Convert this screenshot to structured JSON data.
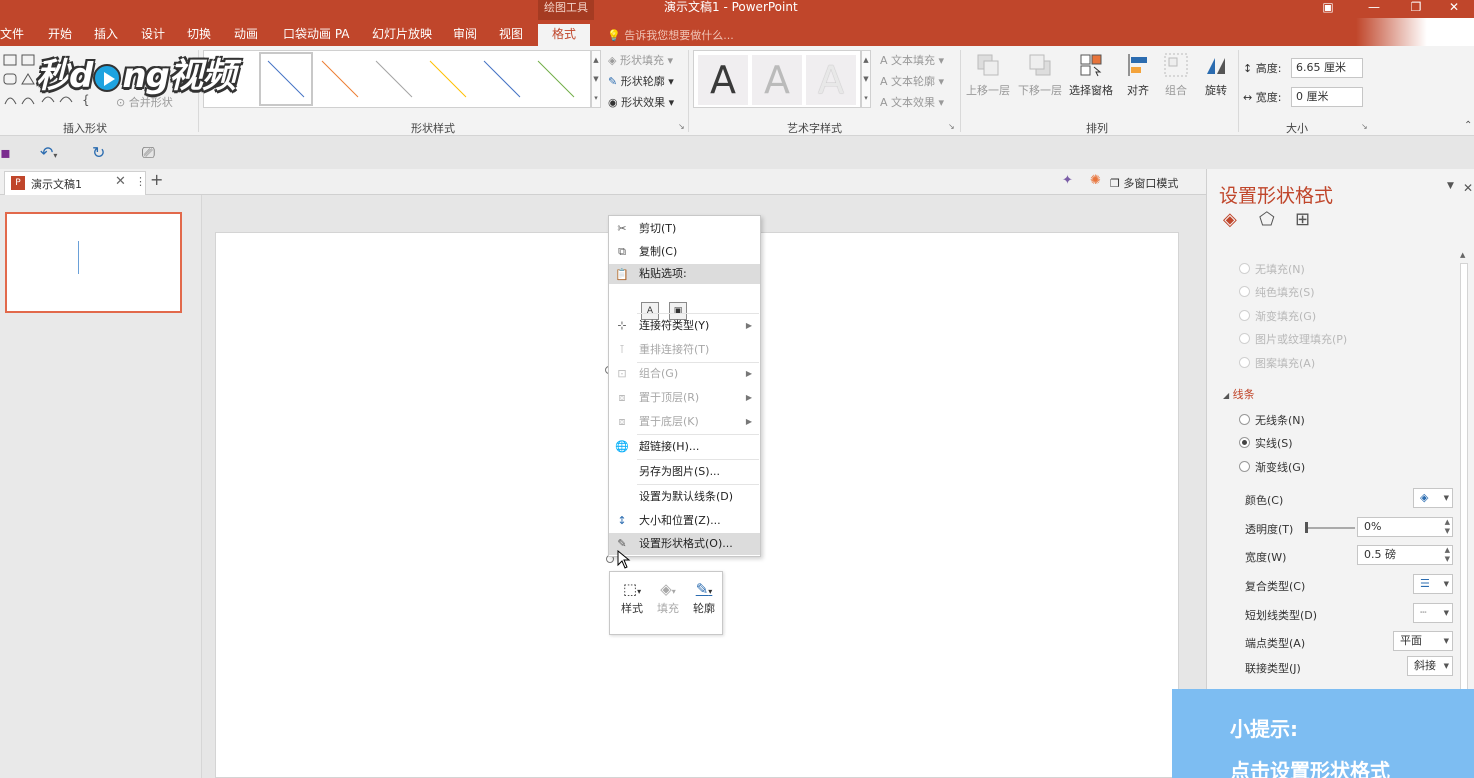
{
  "window": {
    "context_tab": "绘图工具",
    "title": "演示文稿1 - PowerPoint"
  },
  "tabs": [
    {
      "label": "文件"
    },
    {
      "label": "开始"
    },
    {
      "label": "插入"
    },
    {
      "label": "设计"
    },
    {
      "label": "切换"
    },
    {
      "label": "动画"
    },
    {
      "label": "口袋动画 PA"
    },
    {
      "label": "幻灯片放映"
    },
    {
      "label": "审阅"
    },
    {
      "label": "视图"
    },
    {
      "label": "格式"
    }
  ],
  "tellme": "告诉我您想要做什么...",
  "ribbon": {
    "groups": {
      "insert_shapes": "插入形状",
      "shape_styles": "形状样式",
      "wordart_styles": "艺术字样式",
      "arrange": "排列",
      "size": "大小"
    },
    "merge_shapes": "合并形状",
    "shape_fill": "形状填充",
    "shape_outline": "形状轮廓",
    "shape_effects": "形状效果",
    "text_fill": "文本填充",
    "text_outline": "文本轮廓",
    "text_effects": "文本效果",
    "wordart_letter": "A",
    "bring_forward": "上移一层",
    "send_backward": "下移一层",
    "selection_pane": "选择窗格",
    "align": "对齐",
    "group": "组合",
    "rotate": "旋转",
    "height_label": "高度:",
    "height_value": "6.65 厘米",
    "width_label": "宽度:",
    "width_value": "0 厘米"
  },
  "doc_tab": {
    "name": "演示文稿1",
    "multi_window": "多窗口模式"
  },
  "context_menu": {
    "cut": "剪切(T)",
    "copy": "复制(C)",
    "paste_options": "粘贴选项:",
    "connector_type": "连接符类型(Y)",
    "reroute_connectors": "重排连接符(T)",
    "group": "组合(G)",
    "bring_to_front": "置于顶层(R)",
    "send_to_back": "置于底层(K)",
    "hyperlink": "超链接(H)...",
    "save_as_picture": "另存为图片(S)...",
    "set_default_line": "设置为默认线条(D)",
    "size_position": "大小和位置(Z)...",
    "format_shape": "设置形状格式(O)..."
  },
  "mini_toolbar": {
    "style": "样式",
    "fill": "填充",
    "outline": "轮廓"
  },
  "pane": {
    "title": "设置形状格式",
    "fill_options": [
      "无填充(N)",
      "纯色填充(S)",
      "渐变填充(G)",
      "图片或纹理填充(P)",
      "图案填充(A)"
    ],
    "line_section": "线条",
    "line_options": [
      "无线条(N)",
      "实线(S)",
      "渐变线(G)"
    ],
    "color_label": "颜色(C)",
    "transparency_label": "透明度(T)",
    "transparency_value": "0%",
    "width_label": "宽度(W)",
    "width_value": "0.5 磅",
    "compound_label": "复合类型(C)",
    "dash_label": "短划线类型(D)",
    "cap_label": "端点类型(A)",
    "cap_value": "平面",
    "join_label": "联接类型(J)",
    "join_value": "斜接"
  },
  "logo": {
    "part1": "秒",
    "part2": "d",
    "part3": "ng视频"
  },
  "tip": {
    "line1": "小提示:",
    "line2": "点击设置形状格式"
  }
}
